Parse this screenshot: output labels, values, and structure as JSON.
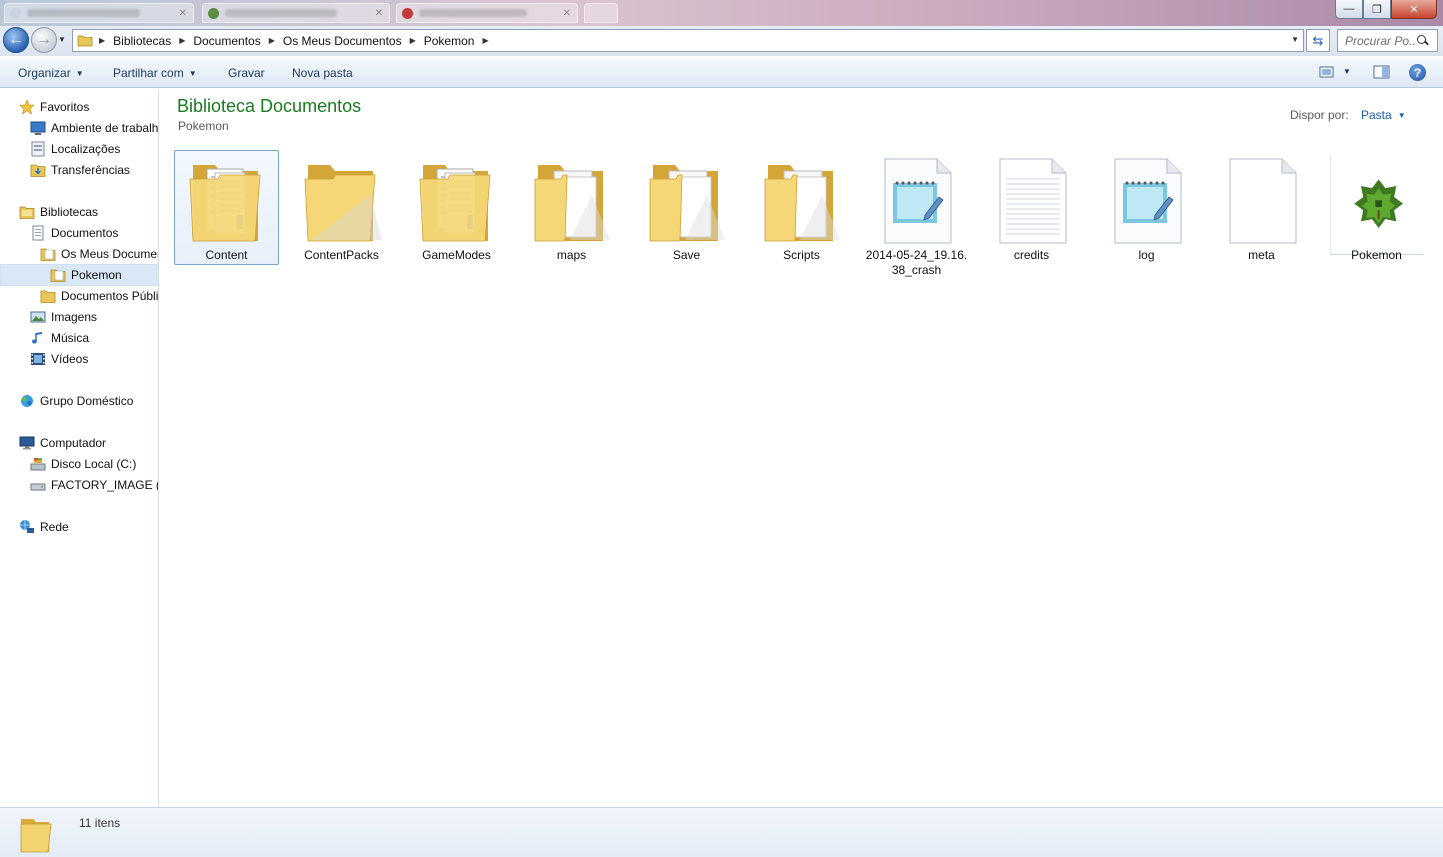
{
  "window": {
    "controls": {
      "minimize": "—",
      "maximize": "❐",
      "close": "✕"
    }
  },
  "address": {
    "breadcrumbs": [
      "Bibliotecas",
      "Documentos",
      "Os Meus Documentos",
      "Pokemon"
    ],
    "search_placeholder": "Procurar Po..."
  },
  "toolbar": {
    "organize": "Organizar",
    "share": "Partilhar com",
    "burn": "Gravar",
    "new_folder": "Nova pasta",
    "help": "?"
  },
  "sidebar": {
    "favorites": "Favoritos",
    "desktop": "Ambiente de trabalho",
    "places": "Localizações",
    "downloads": "Transferências",
    "libraries": "Bibliotecas",
    "documents": "Documentos",
    "my_documents": "Os Meus Documentos",
    "pokemon": "Pokemon",
    "public_documents": "Documentos Públicos",
    "pictures": "Imagens",
    "music": "Música",
    "videos": "Vídeos",
    "homegroup": "Grupo Doméstico",
    "computer": "Computador",
    "local_disk": "Disco Local (C:)",
    "factory_image": "FACTORY_IMAGE (D:)",
    "network": "Rede"
  },
  "main": {
    "library_title": "Biblioteca Documentos",
    "library_subtitle": "Pokemon",
    "arrange_label": "Dispor por:",
    "arrange_value": "Pasta",
    "items": [
      {
        "label": "Content",
        "type": "folder-docs",
        "selected": true
      },
      {
        "label": "ContentPacks",
        "type": "folder-empty"
      },
      {
        "label": "GameModes",
        "type": "folder-docs"
      },
      {
        "label": "maps",
        "type": "folder-pages"
      },
      {
        "label": "Save",
        "type": "folder-pages"
      },
      {
        "label": "Scripts",
        "type": "folder-pages"
      },
      {
        "label": "2014-05-24_19.16.38_crash",
        "display": "2014-05-24_19.16.\n38_crash",
        "type": "notepad"
      },
      {
        "label": "credits",
        "type": "text-doc"
      },
      {
        "label": "log",
        "type": "notepad"
      },
      {
        "label": "meta",
        "type": "blank-doc"
      },
      {
        "label": "Pokemon",
        "type": "app"
      }
    ]
  },
  "status": {
    "item_count": "11 itens"
  },
  "colors": {
    "library_title": "#1b7a22",
    "link_blue": "#1e5fa6",
    "selection": "#d9e8f7"
  }
}
